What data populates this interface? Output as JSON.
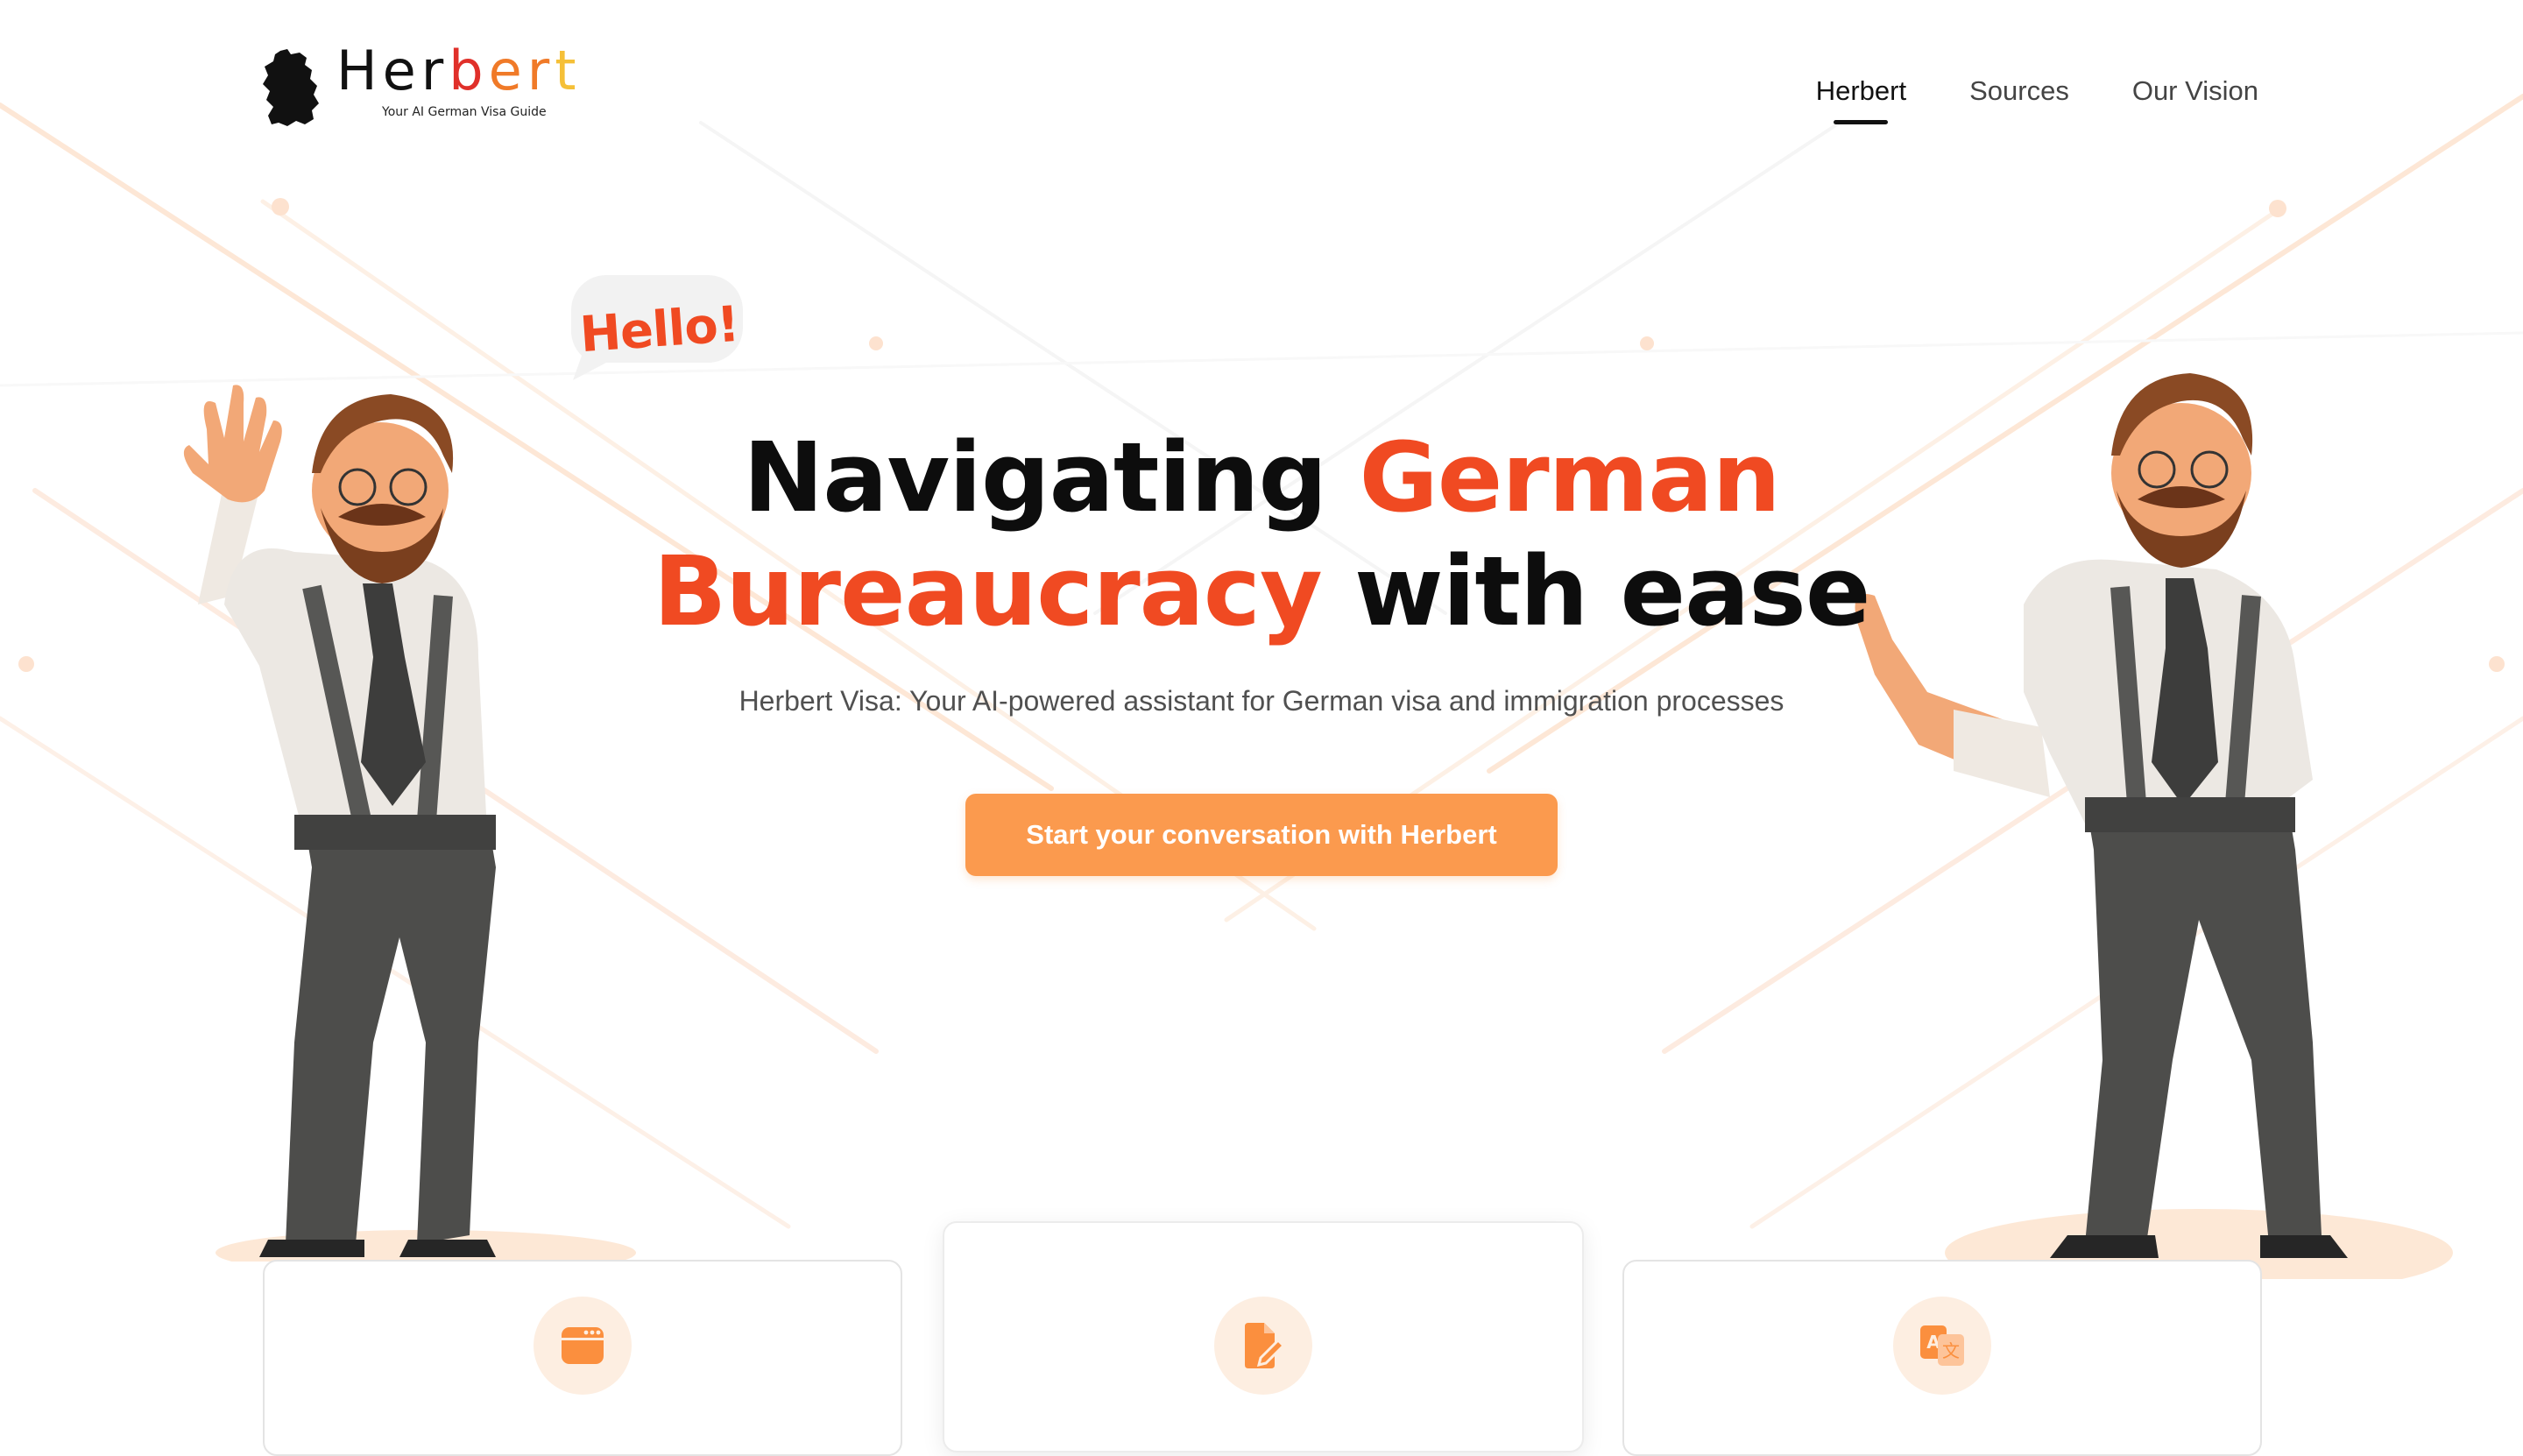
{
  "brand": {
    "name_parts": [
      "Her",
      "b",
      "er",
      "t"
    ],
    "tagline": "Your AI German Visa Guide"
  },
  "nav": {
    "items": [
      "Herbert",
      "Sources",
      "Our Vision"
    ],
    "active": "Herbert"
  },
  "hero": {
    "title_line1_plain": "Navigating ",
    "title_line1_accent": "German",
    "title_line2_accent": "Bureaucracy",
    "title_line2_plain": " with ease",
    "subtitle": "Herbert Visa: Your AI-powered assistant for German visa and immigration processes",
    "cta_label": "Start your conversation with Herbert"
  },
  "bubble": {
    "text": "Hello!"
  },
  "colors": {
    "accent": "#f04a22",
    "cta": "#fb9a4e",
    "icon_bg": "#fdeee1",
    "icon_fg": "#fb8f3e"
  },
  "features": [
    {
      "icon": "browser-window-icon"
    },
    {
      "icon": "document-edit-icon"
    },
    {
      "icon": "translate-icon"
    }
  ]
}
